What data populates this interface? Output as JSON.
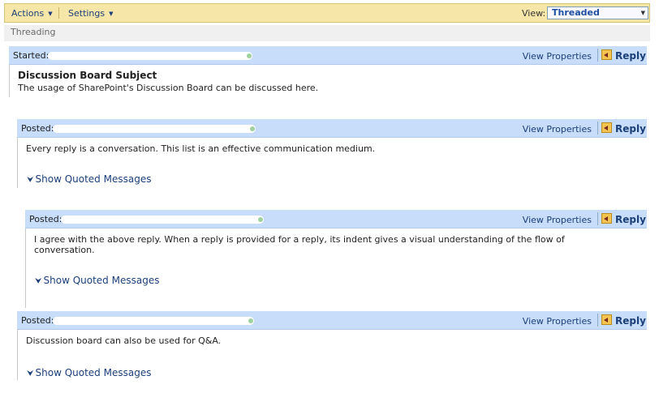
{
  "toolbar": {
    "actions_label": "Actions",
    "settings_label": "Settings",
    "view_label": "View:",
    "view_selected": "Threaded"
  },
  "subbar": {
    "label": "Threading"
  },
  "posts": [
    {
      "label": "Started:",
      "subject": "Discussion Board Subject",
      "body": "The usage of SharePoint's Discussion Board can be discussed here.",
      "view_properties": "View Properties",
      "reply": "Reply"
    },
    {
      "label": "Posted:",
      "body": "Every reply is a conversation. This list is an effective communication medium.",
      "view_properties": "View Properties",
      "reply": "Reply",
      "show_quoted": "Show Quoted Messages"
    },
    {
      "label": "Posted:",
      "body": "I agree with the above reply. When a reply is provided for a reply, its indent gives a visual understanding of the flow of conversation.",
      "view_properties": "View Properties",
      "reply": "Reply",
      "show_quoted": "Show Quoted Messages"
    },
    {
      "label": "Posted:",
      "body": "Discussion board can also be used for Q&A.",
      "view_properties": "View Properties",
      "reply": "Reply",
      "show_quoted": "Show Quoted Messages"
    }
  ],
  "icons": {
    "reply": "reply-icon",
    "chevron": "double-chevron-down-icon"
  }
}
